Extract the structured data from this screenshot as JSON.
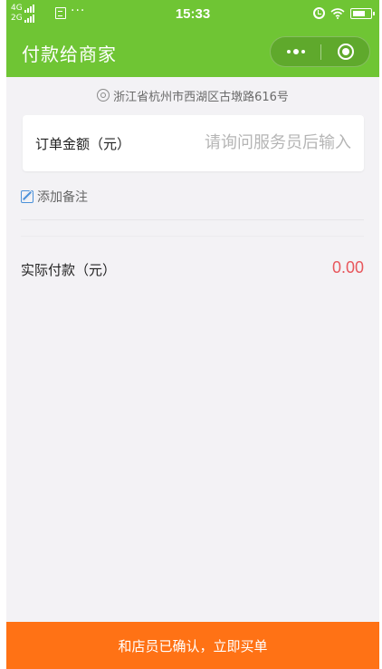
{
  "status_bar": {
    "network_top": "4G",
    "network_bottom": "2G",
    "dots": "···",
    "time": "15:33"
  },
  "header": {
    "title": "付款给商家"
  },
  "address": "浙江省杭州市西湖区古墩路616号",
  "order_amount": {
    "label": "订单金额（元）",
    "placeholder": "请询问服务员后输入",
    "value": ""
  },
  "remark_label": "添加备注",
  "actual_payment": {
    "label": "实际付款（元）",
    "value": "0.00"
  },
  "confirm_button": "和店员已确认，立即买单",
  "colors": {
    "header_bg": "#6fc534",
    "button_bg": "#ff7215",
    "amount_color": "#e8575c",
    "page_bg": "#f3f2f5"
  }
}
